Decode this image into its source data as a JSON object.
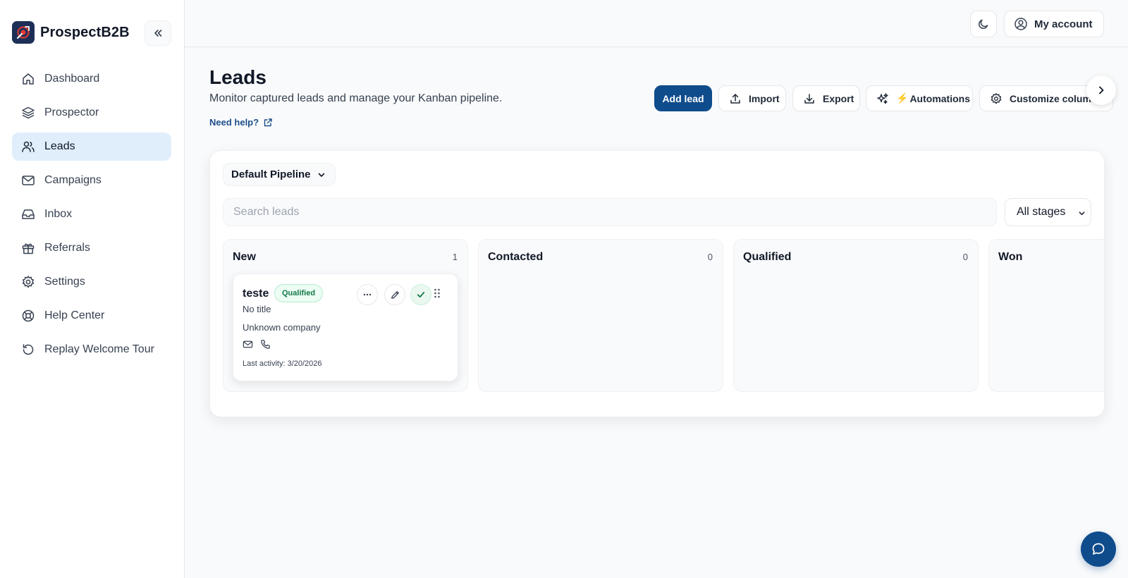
{
  "brand": {
    "name": "ProspectB2B"
  },
  "sidebar": {
    "items": [
      {
        "label": "Dashboard",
        "icon": "home-icon"
      },
      {
        "label": "Prospector",
        "icon": "layers-icon"
      },
      {
        "label": "Leads",
        "icon": "users-icon",
        "active": true
      },
      {
        "label": "Campaigns",
        "icon": "mail-icon"
      },
      {
        "label": "Inbox",
        "icon": "inbox-icon"
      },
      {
        "label": "Referrals",
        "icon": "gift-icon"
      },
      {
        "label": "Settings",
        "icon": "gear-icon"
      },
      {
        "label": "Help Center",
        "icon": "lifebuoy-icon"
      },
      {
        "label": "Replay Welcome Tour",
        "icon": "replay-icon"
      }
    ]
  },
  "topbar": {
    "account_label": "My account"
  },
  "page": {
    "title": "Leads",
    "subtitle": "Monitor captured leads and manage your Kanban pipeline.",
    "help_label": "Need help?"
  },
  "toolbar": {
    "add_label": "Add lead",
    "import_label": "Import",
    "export_label": "Export",
    "automations_bolt": "⚡",
    "automations_label": "Automations",
    "customize_label": "Customize columns"
  },
  "board": {
    "pipeline": "Default Pipeline",
    "search_placeholder": "Search leads",
    "stage_filter": "All stages",
    "columns": [
      {
        "name": "New",
        "count": "1"
      },
      {
        "name": "Contacted",
        "count": "0"
      },
      {
        "name": "Qualified",
        "count": "0"
      },
      {
        "name": "Won",
        "count": ""
      }
    ],
    "cards": [
      {
        "name": "teste",
        "badge": "Qualified",
        "title": "No title",
        "company": "Unknown company",
        "last_activity": "Last activity: 3/20/2026"
      }
    ]
  },
  "colors": {
    "primary": "#0f4c8c",
    "active_nav_bg": "#e0eefc",
    "badge_green": "#16794a",
    "badge_green_bg": "#ecfdf3"
  }
}
